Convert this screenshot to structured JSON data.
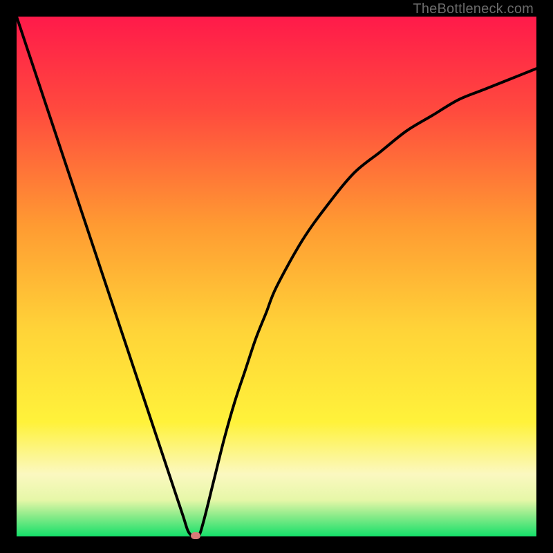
{
  "watermark": "TheBottleneck.com",
  "colors": {
    "top": "#ff1a4a",
    "mid1": "#ff7a3a",
    "mid2": "#ffd23a",
    "mid3": "#fff03a",
    "pale": "#fcf9c8",
    "green": "#19e36e",
    "marker": "#d97a78",
    "curve": "#000000",
    "frame": "#000000"
  },
  "chart_data": {
    "type": "line",
    "title": "",
    "xlabel": "",
    "ylabel": "",
    "xlim": [
      0,
      100
    ],
    "ylim": [
      0,
      100
    ],
    "x": [
      0,
      2,
      4,
      6,
      8,
      10,
      12,
      14,
      16,
      18,
      20,
      22,
      24,
      26,
      28,
      30,
      32,
      33,
      34,
      35,
      36,
      38,
      40,
      42,
      44,
      46,
      48,
      50,
      55,
      60,
      65,
      70,
      75,
      80,
      85,
      90,
      95,
      100
    ],
    "values": [
      100,
      94,
      88,
      82,
      76,
      70,
      64,
      58,
      52,
      46,
      40,
      34,
      28,
      22,
      16,
      10,
      4,
      1,
      0,
      0,
      3,
      11,
      19,
      26,
      32,
      38,
      43,
      48,
      57,
      64,
      70,
      74,
      78,
      81,
      84,
      86,
      88,
      90
    ],
    "marker": {
      "x": 34.5,
      "y": 0
    },
    "grid": false,
    "legend": false
  }
}
